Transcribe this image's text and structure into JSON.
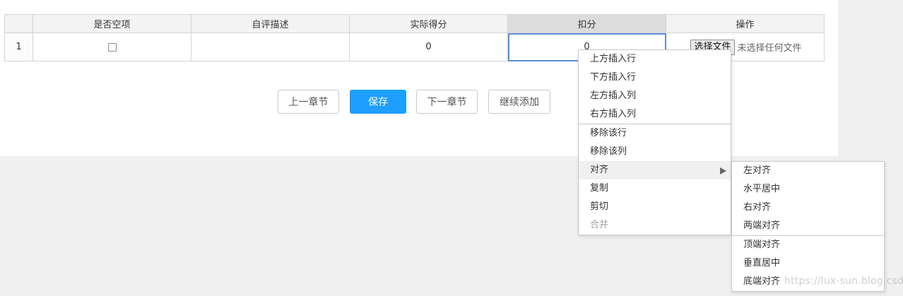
{
  "table": {
    "headers": [
      "",
      "是否空项",
      "自评描述",
      "实际得分",
      "扣分",
      "操作"
    ],
    "row": {
      "index": "1",
      "empty_checked": false,
      "description": "",
      "actual_score": "0",
      "deduction": "0",
      "file_button": "选择文件",
      "file_status": "未选择任何文件"
    }
  },
  "buttons": {
    "prev": "上一章节",
    "save": "保存",
    "next": "下一章节",
    "continue_add": "继续添加"
  },
  "context_menu": {
    "items": [
      {
        "label": "上方插入行"
      },
      {
        "label": "下方插入行"
      },
      {
        "label": "左方插入列"
      },
      {
        "label": "右方插入列"
      },
      {
        "label": "移除该行"
      },
      {
        "label": "移除该列"
      },
      {
        "label": "对齐"
      },
      {
        "label": "复制"
      },
      {
        "label": "剪切"
      },
      {
        "label": "合并"
      }
    ]
  },
  "align_submenu": {
    "items": [
      {
        "label": "左对齐"
      },
      {
        "label": "水平居中"
      },
      {
        "label": "右对齐"
      },
      {
        "label": "两端对齐"
      },
      {
        "label": "顶端对齐"
      },
      {
        "label": "垂直居中"
      },
      {
        "label": "底端对齐"
      }
    ]
  },
  "watermark": "https://lux-sun.blog.csdn.net",
  "colors": {
    "primary": "#1e9fff",
    "active_cell_border": "#5b8fd6",
    "background": "#f0f0f0"
  }
}
